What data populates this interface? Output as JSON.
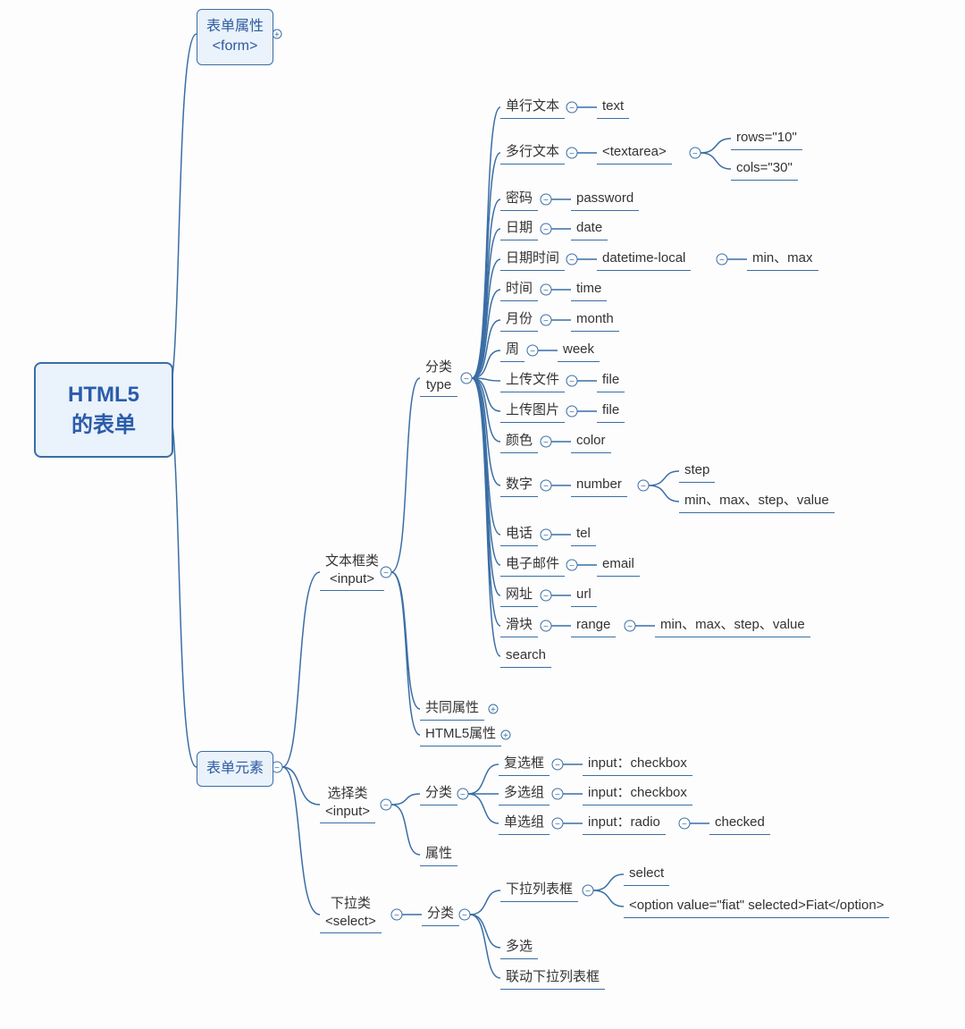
{
  "root": {
    "l1": "HTML5",
    "l2": "的表单"
  },
  "l1": {
    "form_attr": {
      "l1": "表单属性",
      "l2": "<form>"
    },
    "form_elem": "表单元素"
  },
  "l2": {
    "textbox": {
      "l1": "文本框类",
      "l2": "<input>"
    },
    "choice": {
      "l1": "选择类",
      "l2": "<input>"
    },
    "select": {
      "l1": "下拉类",
      "l2": "<select>"
    }
  },
  "textbox": {
    "type": {
      "l1": "分类",
      "l2": "type"
    },
    "common": "共同属性",
    "html5": "HTML5属性"
  },
  "types": {
    "text": {
      "label": "单行文本",
      "val": "text"
    },
    "textarea": {
      "label": "多行文本",
      "val": "<textarea>",
      "rows": "rows=\"10\"",
      "cols": "cols=\"30\""
    },
    "password": {
      "label": "密码",
      "val": "password"
    },
    "date": {
      "label": "日期",
      "val": "date"
    },
    "datetime": {
      "label": "日期时间",
      "val": "datetime-local",
      "minmax": "min、max"
    },
    "time": {
      "label": "时间",
      "val": "time"
    },
    "month": {
      "label": "月份",
      "val": "month"
    },
    "week": {
      "label": "周",
      "val": "week"
    },
    "file": {
      "label": "上传文件",
      "val": "file"
    },
    "image": {
      "label": "上传图片",
      "val": "file"
    },
    "color": {
      "label": "颜色",
      "val": "color"
    },
    "number": {
      "label": "数字",
      "val": "number",
      "step": "step",
      "minmax": "min、max、step、value"
    },
    "tel": {
      "label": "电话",
      "val": "tel"
    },
    "email": {
      "label": "电子邮件",
      "val": "email"
    },
    "url": {
      "label": "网址",
      "val": "url"
    },
    "range": {
      "label": "滑块",
      "val": "range",
      "minmax": "min、max、step、value"
    },
    "search": "search"
  },
  "choice": {
    "type": "分类",
    "attr": "属性",
    "checkbox": {
      "label": "复选框",
      "val": "input：checkbox"
    },
    "multi": {
      "label": "多选组",
      "val": "input：checkbox"
    },
    "radio": {
      "label": "单选组",
      "val": "input：radio",
      "checked": "checked"
    }
  },
  "select": {
    "type": "分类",
    "dropdown": {
      "label": "下拉列表框",
      "selectTag": "select",
      "option": "<option value=\"fiat\" selected>Fiat</option>"
    },
    "multi": "多选",
    "linked": "联动下拉列表框"
  }
}
